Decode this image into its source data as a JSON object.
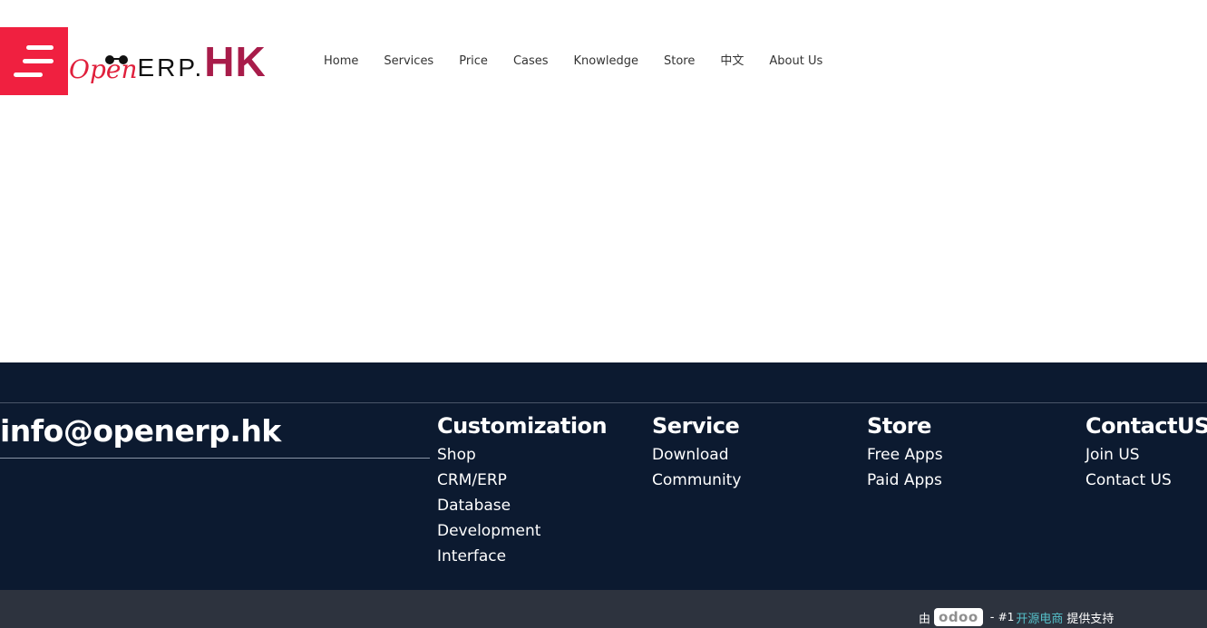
{
  "header": {
    "menu_icon": "hamburger-menu-icon",
    "menu_color": "#f02040",
    "logo": {
      "open": "Open",
      "erp": "ERP.",
      "hk": "HK",
      "open_color": "#e0203c",
      "hk_color": "#a81c4a"
    },
    "nav": [
      "Home",
      "Services",
      "Price",
      "Cases",
      "Knowledge",
      "Store",
      "中文",
      "About Us"
    ]
  },
  "footer": {
    "background": "#0c1a30",
    "email": "info@openerp.hk",
    "columns": [
      {
        "title": "Customization",
        "links": [
          "Shop",
          "CRM/ERP",
          "Database",
          "Development",
          "Interface"
        ]
      },
      {
        "title": "Service",
        "links": [
          "Download",
          "Community"
        ]
      },
      {
        "title": "Store",
        "links": [
          "Free Apps",
          "Paid Apps"
        ]
      },
      {
        "title": "ContactUS",
        "links": [
          "Join US",
          "Contact US"
        ]
      }
    ]
  },
  "bottombar": {
    "prefix": "由",
    "odoo_badge": "odoo",
    "dash": " - ",
    "rank": "#1",
    "highlight": "开源电商",
    "suffix": "提供支持",
    "highlight_color": "#55c0c9"
  }
}
